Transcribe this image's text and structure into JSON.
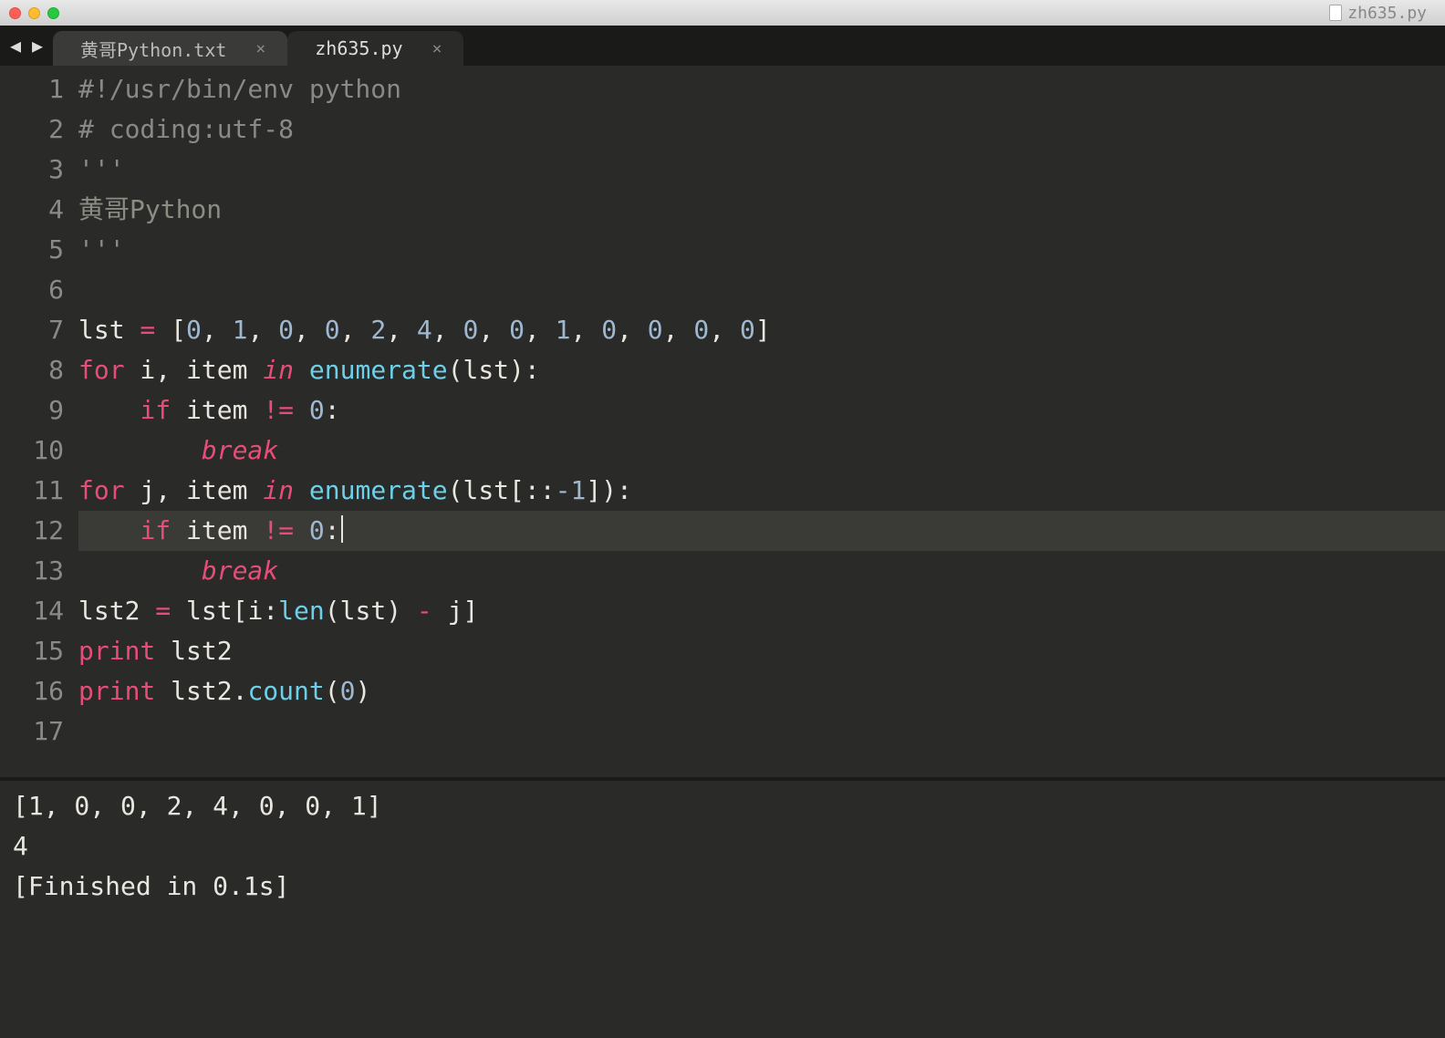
{
  "titlebar": {
    "filename": "zh635.py"
  },
  "tabs": [
    {
      "label": "黄哥Python.txt",
      "active": false
    },
    {
      "label": "zh635.py",
      "active": true
    }
  ],
  "editor": {
    "line_count": 17,
    "highlighted_line": 12,
    "code": {
      "l1": {
        "shebang": "#!/usr/bin/env python"
      },
      "l2": {
        "coding": "# coding:utf-8"
      },
      "l3": {
        "triple": "'''"
      },
      "l4": {
        "doc": "黄哥Python"
      },
      "l5": {
        "triple": "'''"
      },
      "l6": {
        "blank": ""
      },
      "l7": {
        "var": "lst",
        "assign": " = ",
        "open": "[",
        "values": [
          "0",
          "1",
          "0",
          "0",
          "2",
          "4",
          "0",
          "0",
          "1",
          "0",
          "0",
          "0",
          "0"
        ],
        "close": "]"
      },
      "l8": {
        "kw_for": "for",
        "i": " i",
        "comma": ", ",
        "item": "item ",
        "kw_in": "in",
        "sp": " ",
        "fn": "enumerate",
        "open": "(",
        "arg": "lst",
        "close": "):"
      },
      "l9": {
        "indent": "    ",
        "kw_if": "if",
        "sp1": " ",
        "item": "item ",
        "op": "!=",
        "sp2": " ",
        "zero": "0",
        "colon": ":"
      },
      "l10": {
        "indent": "        ",
        "kw_break": "break"
      },
      "l11": {
        "kw_for": "for",
        "j": " j",
        "comma": ", ",
        "item": "item ",
        "kw_in": "in",
        "sp": " ",
        "fn": "enumerate",
        "open": "(",
        "arg": "lst[::",
        "neg1": "-1",
        "close": "]):"
      },
      "l12": {
        "indent": "    ",
        "kw_if": "if",
        "sp1": " ",
        "item": "item ",
        "op": "!=",
        "sp2": " ",
        "zero": "0",
        "colon": ":"
      },
      "l13": {
        "indent": "        ",
        "kw_break": "break"
      },
      "l14": {
        "var": "lst2",
        "assign": " = ",
        "expr1": "lst[i:",
        "fn": "len",
        "open": "(",
        "arg": "lst",
        "close": ") ",
        "minus": "-",
        "tail": " j]"
      },
      "l15": {
        "kw_print": "print",
        "sp": " ",
        "arg": "lst2"
      },
      "l16": {
        "kw_print": "print",
        "sp": " ",
        "obj": "lst2.",
        "fn": "count",
        "open": "(",
        "zero": "0",
        "close": ")"
      },
      "l17": {
        "blank": ""
      }
    }
  },
  "output": {
    "l1": "[1, 0, 0, 2, 4, 0, 0, 1]",
    "l2": "4",
    "l3": "[Finished in 0.1s]"
  }
}
